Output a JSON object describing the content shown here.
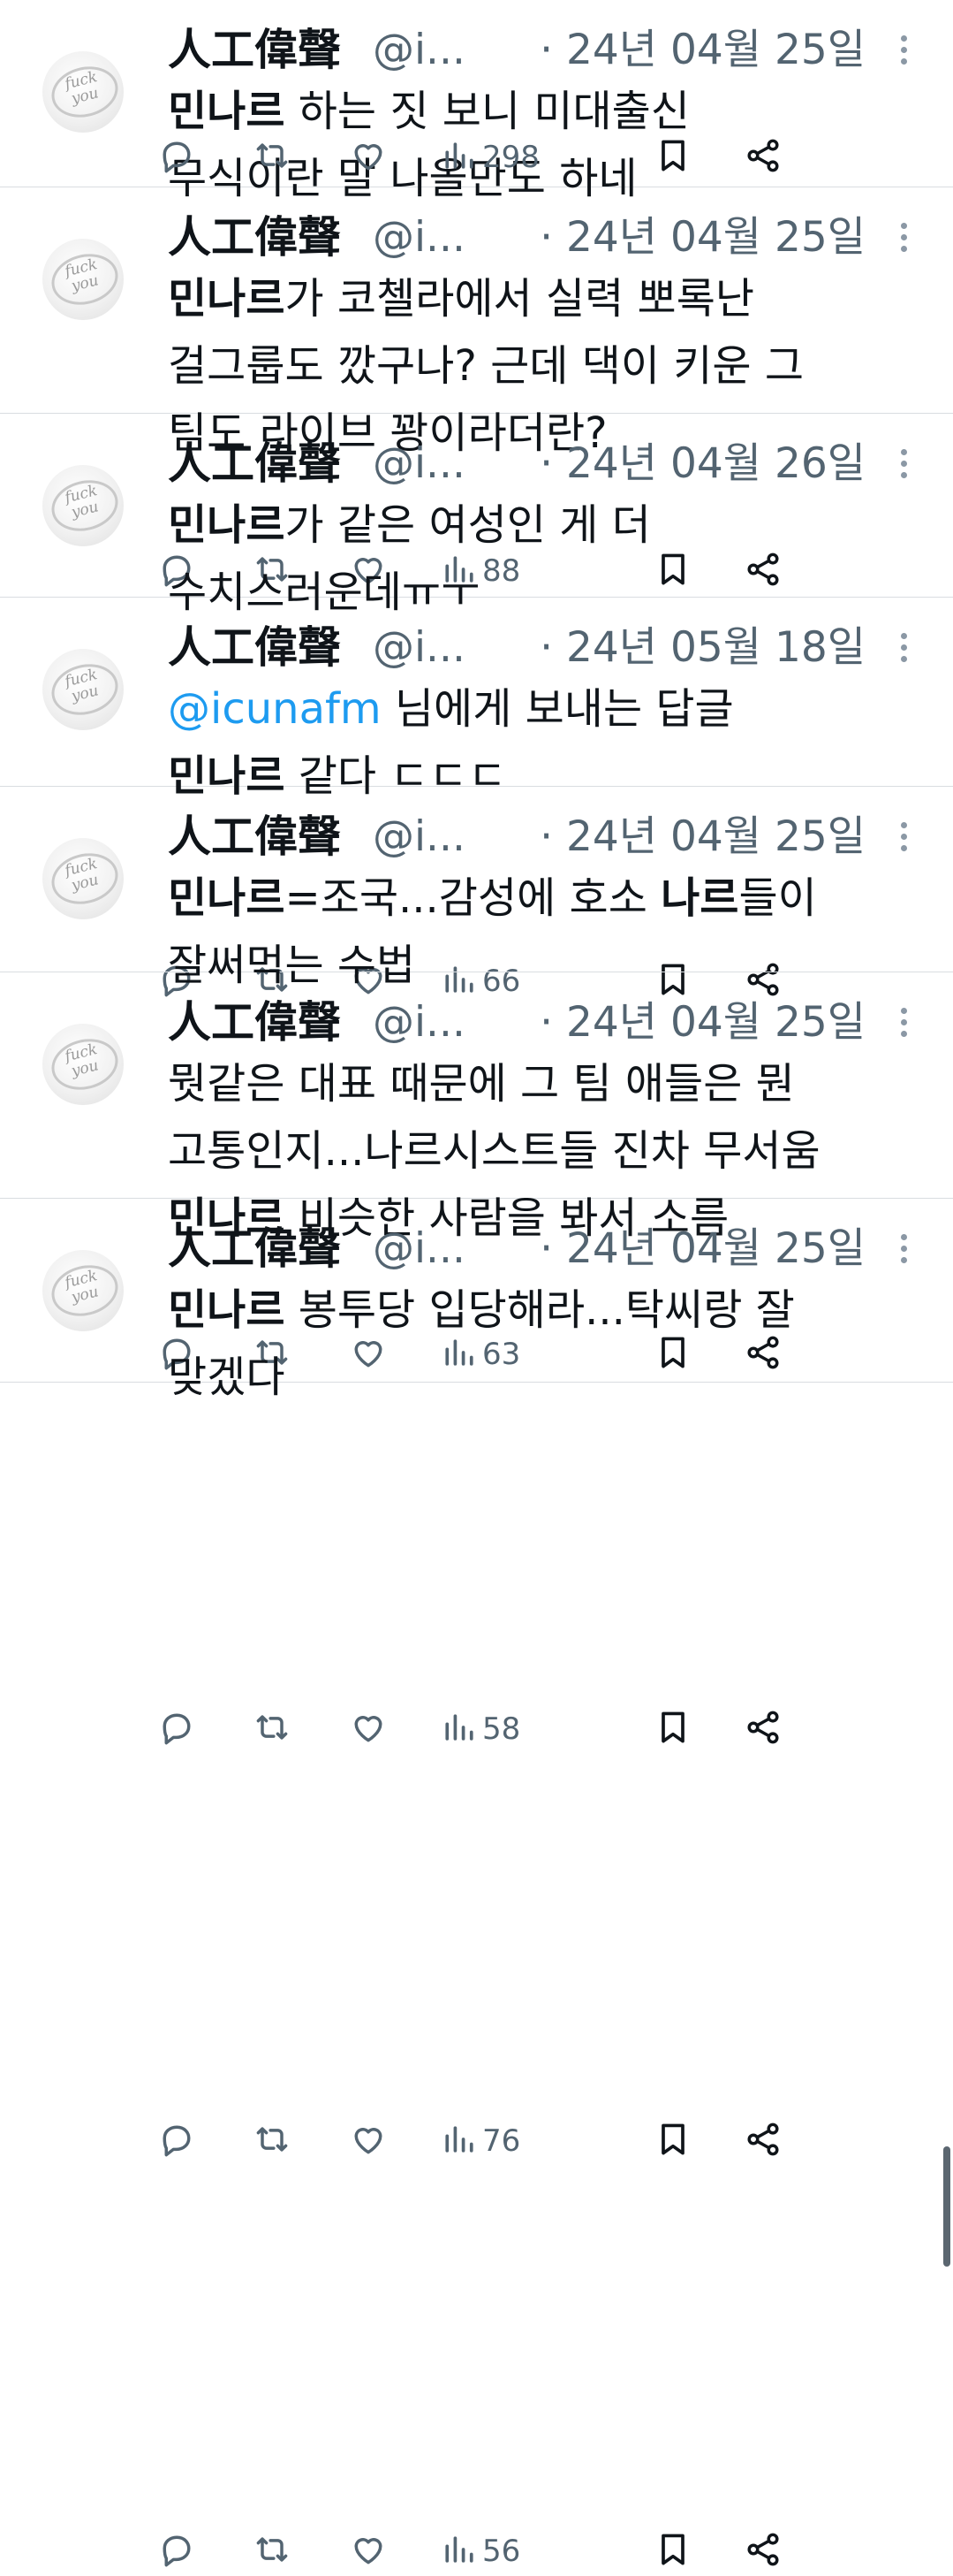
{
  "author": {
    "name": "人工偉聲",
    "handle": "@i..."
  },
  "icons": {
    "reply": "reply-icon",
    "retweet": "retweet-icon",
    "like": "heart-icon",
    "views": "views-icon",
    "bookmark": "bookmark-icon",
    "share": "share-icon",
    "more": "more-icon"
  },
  "colors": {
    "text": "#0f1419",
    "muted": "#536471",
    "link": "#1d9bf0",
    "divider": "#d9dde1"
  },
  "tweets": [
    {
      "date": "· 24년 04월 25일",
      "views": "298",
      "lines": [
        {
          "bold": "민나르",
          "text": " 하는 짓 보니 미대출신"
        },
        {
          "text": "무식이란 말 나올만도 하네"
        }
      ]
    },
    {
      "date": "· 24년 04월 25일",
      "views": "88",
      "lines": [
        {
          "bold": "민나르",
          "text": "가 코첼라에서 실력 뽀록난"
        },
        {
          "text": "걸그룹도 깠구나? 근데 댁이 키운 그"
        },
        {
          "text": "팀도 라이브 꽝이라더란?"
        }
      ]
    },
    {
      "date": "· 24년 04월 26일",
      "views": "66",
      "lines": [
        {
          "bold": "민나르",
          "text": "가 같은 여성인 게 더"
        },
        {
          "text": "수치스러운데ㅠㅜ"
        }
      ]
    },
    {
      "date": "· 24년 05월 18일",
      "views": "63",
      "reply_to": {
        "mention": "@icunafm",
        "suffix": " 님에게 보내는 답글"
      },
      "lines": [
        {
          "bold": "민나르",
          "text": " 같다 ㄷㄷㄷ"
        }
      ]
    },
    {
      "date": "· 24년 04월 25일",
      "views": "58",
      "lines": [
        {
          "bold": "민나르",
          "text": "=조국...감성에 호소 ",
          "bold2": "나르",
          "text2": "들이"
        },
        {
          "text": "잘써먹는 수법"
        }
      ]
    },
    {
      "date": "· 24년 04월 25일",
      "views": "76",
      "lines": [
        {
          "text": "뭣같은 대표 때문에 그 팀 애들은 뭔"
        },
        {
          "text": "고통인지...나르시스트들 진차 무서움"
        },
        {
          "bold": "민나르",
          "text": " 비슷한 사람을 봐서 소름"
        }
      ]
    },
    {
      "date": "· 24년 04월 25일",
      "views": "56",
      "lines": [
        {
          "bold": "민나르",
          "text": " 봉투당 입당해라...탁씨랑 잘"
        },
        {
          "text": "맞겠다"
        }
      ]
    }
  ]
}
